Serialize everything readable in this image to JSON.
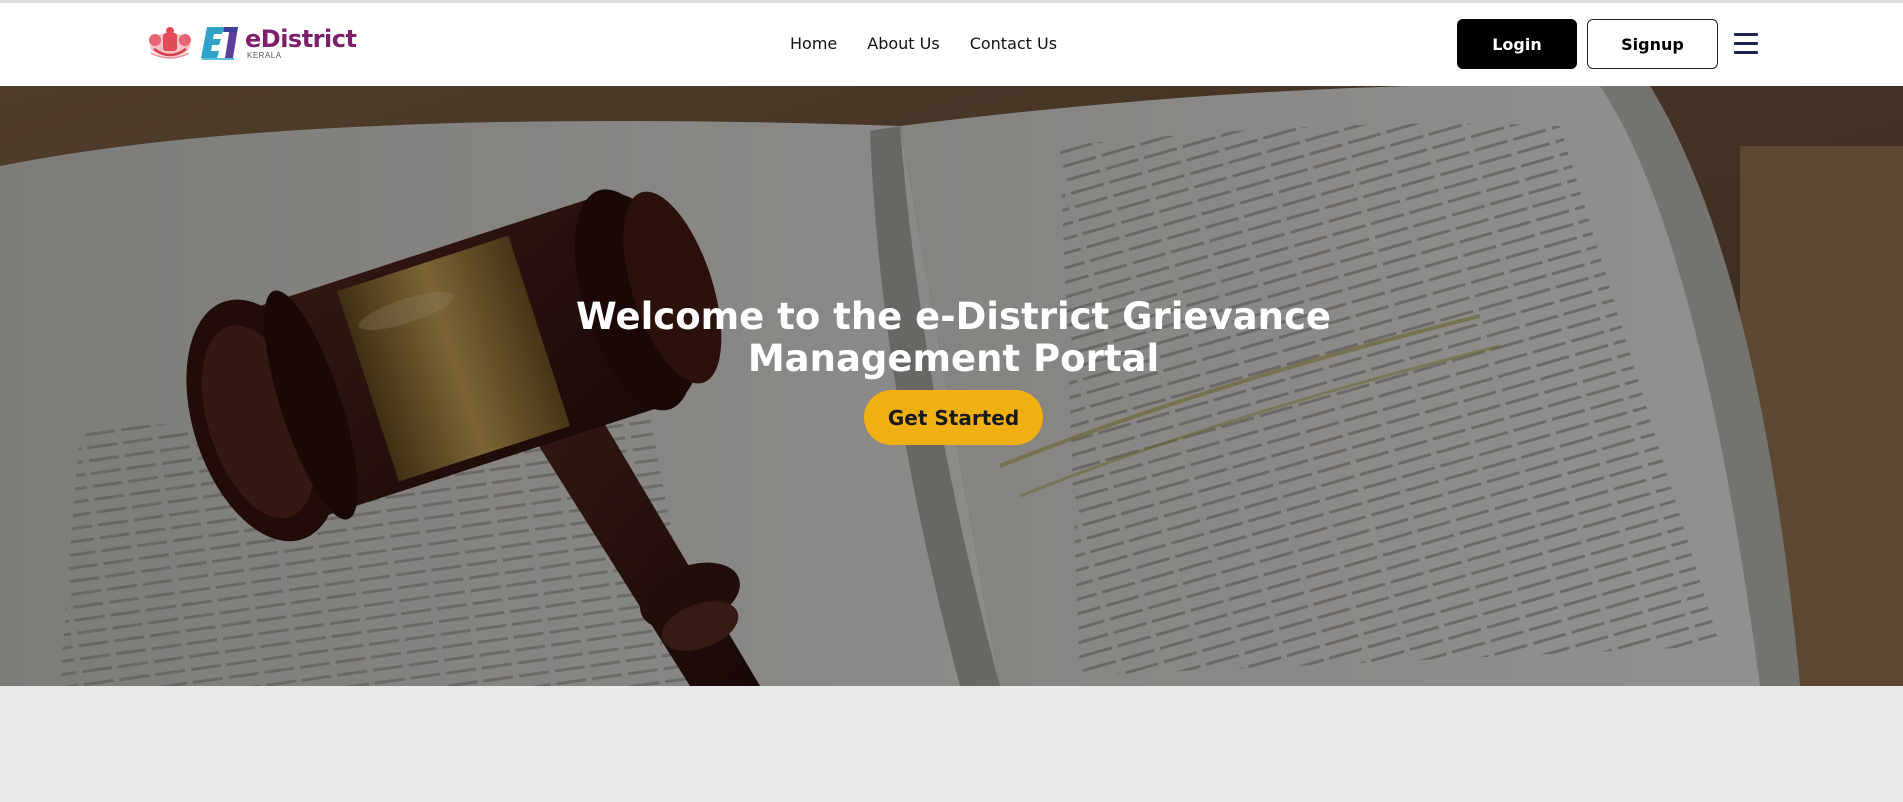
{
  "header": {
    "logo": {
      "title": "eDistrict",
      "subtitle": "KERALA",
      "mark_letters": "EN",
      "colors": {
        "brand": "#7d1f6a",
        "emblem": "#e14b5a",
        "mark": "#2ea3c7"
      }
    },
    "nav": {
      "home": "Home",
      "about": "About Us",
      "contact": "Contact Us"
    },
    "login_label": "Login",
    "signup_label": "Signup",
    "menu_icon": "hamburger-menu-icon"
  },
  "hero": {
    "title": "Welcome to the e-District Grievance Management Portal",
    "cta_label": "Get Started",
    "background": "gavel-on-open-book",
    "cta_color": "#f0b011"
  }
}
